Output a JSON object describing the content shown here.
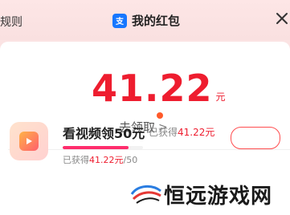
{
  "header": {
    "rules_label": "规则",
    "title": "我的红包",
    "app_icon": "alipay-icon",
    "close_icon": "close-icon"
  },
  "balance": {
    "amount": "41.22",
    "unit": "元",
    "claim_label": "去领取",
    "claim_chevron": ">"
  },
  "task": {
    "icon": "video-play-icon",
    "title": "看视频领50元",
    "earned_prefix": "已获得",
    "earned_value": "41.22元",
    "progress_prefix": "已获得",
    "progress_value": "41.22元",
    "progress_total": "/50",
    "progress_fraction": 0.8244,
    "accent": "#ff2d6d"
  },
  "watermark": {
    "text": "恒远游戏网",
    "logo": "hengyuan-logo"
  },
  "colors": {
    "accent_red": "#ee1d2f",
    "header_bg": "#fbe3e3",
    "brand_blue": "#1677ff"
  }
}
